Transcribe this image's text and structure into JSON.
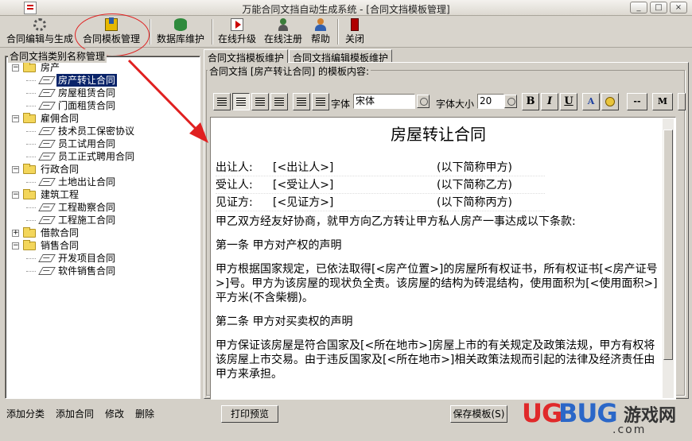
{
  "window": {
    "title": "万能合同文挡自动生成系统 - [合同文挡模板管理]",
    "controls": [
      "_",
      "□",
      "×"
    ]
  },
  "toolbar": [
    {
      "label": "合同编辑与生成",
      "icon": "gear-icon"
    },
    {
      "label": "合同模板管理",
      "icon": "template-icon"
    },
    {
      "label": "数据库维护",
      "icon": "database-icon"
    },
    {
      "label": "在线升级",
      "icon": "upgrade-icon"
    },
    {
      "label": "在线注册",
      "icon": "register-icon"
    },
    {
      "label": "帮助",
      "icon": "help-icon"
    },
    {
      "label": "关闭",
      "icon": "exit-icon"
    }
  ],
  "left": {
    "group_title": "合同文挡类别名称管理",
    "tree": [
      {
        "label": "房产",
        "children": [
          "房产转让合同",
          "房屋租赁合同",
          "门面租赁合同"
        ]
      },
      {
        "label": "雇佣合同",
        "children": [
          "技术员工保密协议",
          "员工试用合同",
          "员工正式聘用合同"
        ]
      },
      {
        "label": "行政合同",
        "children": [
          "土地出让合同"
        ]
      },
      {
        "label": "建筑工程",
        "children": [
          "工程勘察合同",
          "工程施工合同"
        ]
      },
      {
        "label": "借款合同",
        "children": []
      },
      {
        "label": "销售合同",
        "children": [
          "开发项目合同",
          "软件销售合同"
        ]
      }
    ],
    "selected": "房产转让合同",
    "actions": [
      "添加分类",
      "添加合同",
      "修改",
      "删除"
    ]
  },
  "tabs": [
    "合同文挡模板维护",
    "合同文挡编辑模板维护"
  ],
  "editor_group_title": "合同文挡 [房产转让合同] 的模板内容:",
  "format": {
    "font_label": "字体",
    "font_value": "宋体",
    "size_label": "字体大小",
    "size_value": "20",
    "bold": "B",
    "italic": "I",
    "underline": "U",
    "extra": [
      "--",
      "M"
    ]
  },
  "document": {
    "title": "房屋转让合同",
    "parties": [
      {
        "role": "出让人:",
        "placeholder": "[<出让人>]",
        "note": "(以下简称甲方)"
      },
      {
        "role": "受让人:",
        "placeholder": "[<受让人>]",
        "note": "(以下简称乙方)"
      },
      {
        "role": "见证方:",
        "placeholder": "[<见证方>]",
        "note": "(以下简称丙方)"
      }
    ],
    "intro": "甲乙双方经友好协商，就甲方向乙方转让甲方私人房产一事达成以下条款:",
    "art1_title": "第一条    甲方对产权的声明",
    "art1_body": "甲方根据国家规定，已依法取得[<房产位置>]的房屋所有权证书，所有权证书[<房产证号>]号。甲方为该房屋的现状负全责。该房屋的结构为砖混结构，使用面积为[<使用面积>]平方米(不含柴棚)。",
    "art2_title": "第二条    甲方对买卖权的声明",
    "art2_body": "甲方保证该房屋是符合国家及[<所在地市>]房屋上市的有关规定及政策法规，甲方有权将该房屋上市交易。由于违反国家及[<所在地市>]相关政策法规而引起的法律及经济责任由甲方来承担。"
  },
  "buttons": {
    "print_preview": "打印预览",
    "save_template": "保存模板(S)"
  },
  "watermark": {
    "ug": "UG",
    "bug": "BUG",
    "cn": "游戏网",
    "com": ".com"
  },
  "colors": {
    "selection": "#0a246a",
    "annotation_red": "#e02020"
  }
}
